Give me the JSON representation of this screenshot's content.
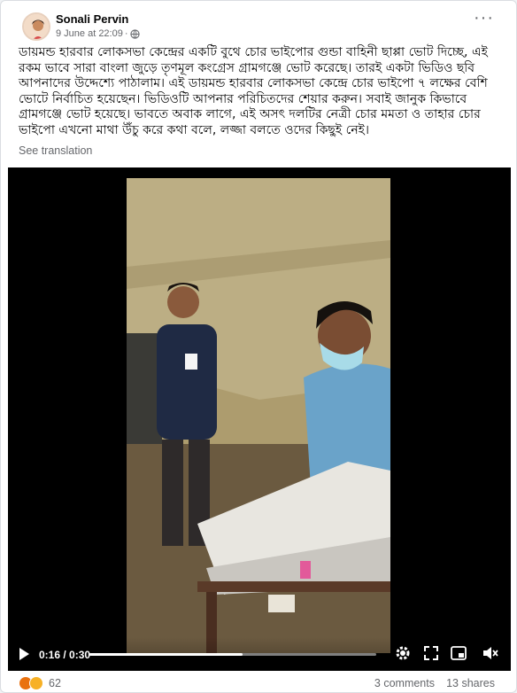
{
  "post": {
    "author": "Sonali Pervin",
    "date": "9 June at 22:09",
    "date_separator": "·",
    "text": "ডায়মন্ড হারবার লোকসভা  কেন্দ্রের একটি বুথে চোর ভাইপোর গুন্ডা বাহিনী ছাপ্পা ভোট দিচ্ছে, এই রকম ভাবে সারা বাংলা জুড়ে তৃণমূল কংগ্রেস গ্রামগঞ্জে ভোট করেছে। তারই একটা ভিডিও ছবি আপনাদের উদ্দেশ্যে পাঠালাম। এই ডায়মন্ড হারবার লোকসভা কেন্দ্রে চোর ভাইপো ৭ লক্ষের বেশি ভোটে নির্বাচিত হয়েছেন। ভিডিওটি আপনার পরিচিতদের শেয়ার করুন। সবাই জানুক কিভাবে গ্রামগঞ্জে ভোট হয়েছে। ভাবতে অবাক লাগে, এই অসৎ দলটির নেত্রী চোর মমতা ও তাহার চোর ভাইপো এখনো মাথা উঁচু করে কথা বলে, লজ্জা বলতে ওদের কিছুই নেই।",
    "see_translation": "See translation"
  },
  "video": {
    "current_time": "0:16",
    "duration": "0:30",
    "time_display": "0:16 / 0:30",
    "progress_fraction": 0.533,
    "icons": [
      "play-icon",
      "settings-icon",
      "fullscreen-icon",
      "pip-icon",
      "mute-icon"
    ]
  },
  "footer": {
    "reaction_count": "62",
    "comments": "3 comments",
    "shares": "13 shares"
  },
  "colors": {
    "text_primary": "#050505",
    "text_secondary": "#65676b",
    "like_blue": "#1877f2",
    "haha_yellow": "#f7b125",
    "angry_red": "#e9710f"
  }
}
